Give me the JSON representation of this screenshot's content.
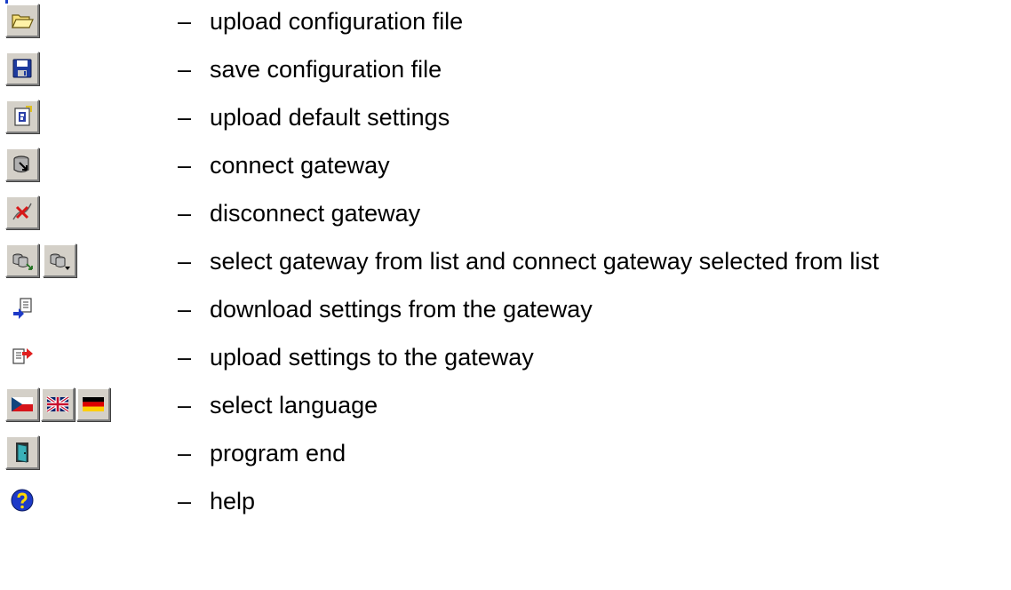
{
  "legend": {
    "dash": "–",
    "items": [
      {
        "icons": [
          "folder-open-icon"
        ],
        "label": "upload configuration file"
      },
      {
        "icons": [
          "floppy-disk-icon"
        ],
        "label": "save configuration file"
      },
      {
        "icons": [
          "default-settings-icon"
        ],
        "label": "upload default settings"
      },
      {
        "icons": [
          "connect-gateway-icon"
        ],
        "label": "connect gateway"
      },
      {
        "icons": [
          "disconnect-icon"
        ],
        "label": "disconnect gateway"
      },
      {
        "icons": [
          "select-gateway-icon",
          "connect-selected-gateway-icon"
        ],
        "label": "select gateway from list and connect gateway selected from list"
      },
      {
        "icons": [
          "download-settings-icon"
        ],
        "label": "download settings from the gateway"
      },
      {
        "icons": [
          "upload-settings-icon"
        ],
        "label": "upload settings to the gateway"
      },
      {
        "icons": [
          "czech-flag-icon",
          "uk-flag-icon",
          "german-flag-icon"
        ],
        "label": "select language"
      },
      {
        "icons": [
          "exit-door-icon"
        ],
        "label": "program end"
      },
      {
        "icons": [
          "help-icon"
        ],
        "label": "help"
      }
    ]
  }
}
